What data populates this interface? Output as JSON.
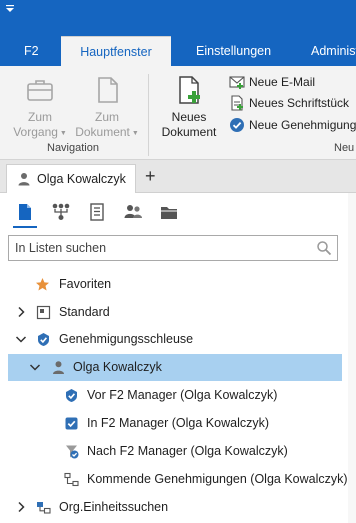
{
  "ribbon": {
    "tabs": [
      {
        "label": "F2"
      },
      {
        "label": "Hauptfenster"
      },
      {
        "label": "Einstellungen"
      },
      {
        "label": "Administ"
      }
    ],
    "navigation": {
      "zum_vorgang": {
        "line1": "Zum",
        "line2": "Vorgang"
      },
      "zum_dokument": {
        "line1": "Zum",
        "line2": "Dokument"
      },
      "group_label": "Navigation"
    },
    "neues_dokument": {
      "line1": "Neues",
      "line2": "Dokument"
    },
    "small_buttons": [
      {
        "label": "Neue E-Mail",
        "icon": "email-icon"
      },
      {
        "label": "Neues Schriftstück",
        "icon": "document-icon"
      },
      {
        "label": "Neue Genehmigung",
        "icon": "approval-check-icon"
      }
    ],
    "group_label_new": "Neu"
  },
  "doc_tab": {
    "label": "Olga Kowalczyk",
    "add_symbol": "+"
  },
  "view_icons": [
    "document-view-icon",
    "org-chart-icon",
    "list-view-icon",
    "users-icon",
    "folder-view-icon"
  ],
  "search": {
    "placeholder": "In Listen suchen",
    "value": ""
  },
  "tree": {
    "favoriten": "Favoriten",
    "standard": "Standard",
    "genehmigungsschleuse": "Genehmigungsschleuse",
    "olga": "Olga Kowalczyk",
    "vor": "Vor F2 Manager (Olga Kowalczyk)",
    "in": "In F2 Manager (Olga Kowalczyk)",
    "nach": "Nach F2 Manager (Olga Kowalczyk)",
    "kommende": "Kommende Genehmigungen (Olga Kowalczyk)",
    "org": "Org.Einheitssuchen"
  },
  "colors": {
    "accent": "#1565c0",
    "selection": "#a8d0f0",
    "favorite_star": "#e8913a",
    "add_green": "#3aa13a"
  }
}
